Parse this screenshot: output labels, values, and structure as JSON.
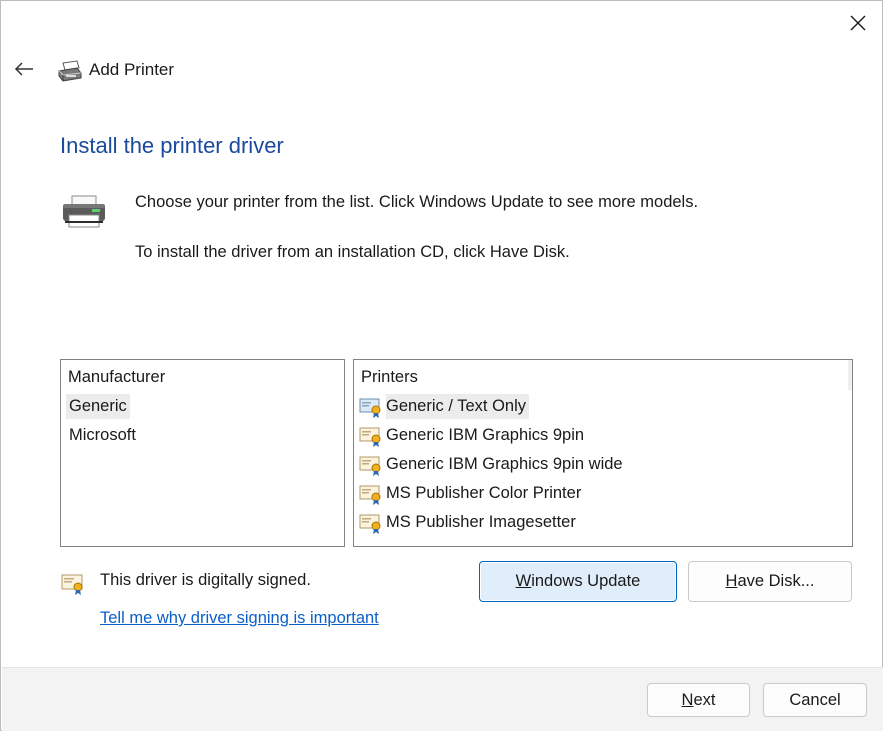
{
  "window": {
    "title": "Add Printer",
    "close_icon": "close-icon",
    "back_icon": "back-arrow-icon",
    "title_icon": "printer-wizard-icon"
  },
  "page": {
    "heading": "Install the printer driver",
    "instruction_1": "Choose your printer from the list. Click Windows Update to see more models.",
    "instruction_2": "To install the driver from an installation CD, click Have Disk.",
    "page_icon": "printer-icon"
  },
  "manufacturer_list": {
    "header": "Manufacturer",
    "items": [
      {
        "label": "Generic",
        "selected": true
      },
      {
        "label": "Microsoft",
        "selected": false
      }
    ]
  },
  "printers_list": {
    "header": "Printers",
    "item_icon": "signed-driver-icon",
    "items": [
      {
        "label": "Generic / Text Only",
        "selected": true
      },
      {
        "label": "Generic IBM Graphics 9pin",
        "selected": false
      },
      {
        "label": "Generic IBM Graphics 9pin wide",
        "selected": false
      },
      {
        "label": "MS Publisher Color Printer",
        "selected": false
      },
      {
        "label": "MS Publisher Imagesetter",
        "selected": false
      }
    ]
  },
  "signature": {
    "icon": "certificate-icon",
    "text": "This driver is digitally signed.",
    "link": "Tell me why driver signing is important"
  },
  "buttons": {
    "windows_update_accel": "W",
    "windows_update_rest": "indows Update",
    "have_disk_accel": "H",
    "have_disk_rest": "ave Disk...",
    "next_accel": "N",
    "next_rest": "ext",
    "cancel": "Cancel"
  },
  "colors": {
    "heading": "#1a4a9e",
    "link": "#0a5fcb",
    "primary_button_border": "#0067c0",
    "primary_button_fill": "#e0eefb",
    "footer_bg": "#f3f3f3"
  }
}
